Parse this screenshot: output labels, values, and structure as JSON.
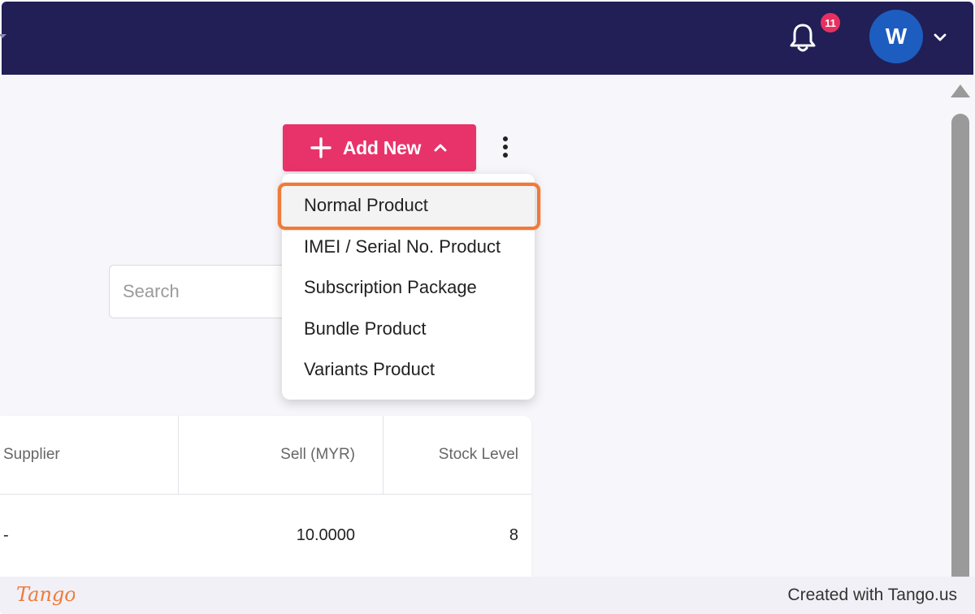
{
  "header": {
    "notification_count": "11",
    "avatar_initial": "W"
  },
  "toolbar": {
    "add_new_label": "Add New"
  },
  "search": {
    "placeholder": "Search"
  },
  "add_menu": {
    "items": [
      {
        "label": "Normal Product",
        "highlighted": true
      },
      {
        "label": "IMEI / Serial No. Product"
      },
      {
        "label": "Subscription Package"
      },
      {
        "label": "Bundle Product"
      },
      {
        "label": "Variants Product"
      }
    ]
  },
  "table": {
    "columns": [
      "Supplier",
      "Sell (MYR)",
      "Stock Level"
    ],
    "rows": [
      [
        "-",
        "10.0000",
        "8"
      ]
    ]
  },
  "footer": {
    "logo_text": "Tango",
    "created_with": "Created with Tango.us"
  },
  "colors": {
    "navbar": "#211f56",
    "accent": "#e8336a",
    "avatar": "#1d5dbf",
    "highlight_ring": "#f07a3a",
    "badge": "#e83060"
  },
  "icons": {
    "bell": "bell-icon",
    "chevron_down": "chevron-down-icon",
    "plus": "plus-icon",
    "chevron_up": "chevron-up-icon",
    "more": "more-vertical-icon"
  }
}
